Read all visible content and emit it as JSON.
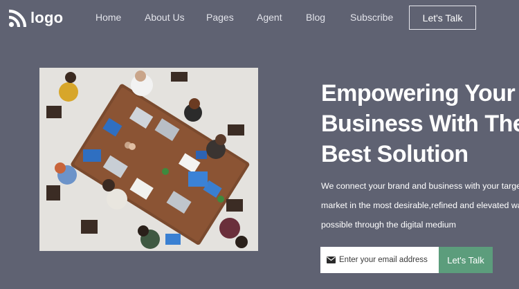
{
  "brand": {
    "logo_text": "logo",
    "logo_icon": "rss-feed-icon"
  },
  "nav": {
    "links": [
      "Home",
      "About Us",
      "Pages",
      "Agent",
      "Blog",
      "Subscribe"
    ],
    "cta_label": "Let's Talk"
  },
  "hero": {
    "image": "team-meeting-overhead-photo",
    "headline_lines": [
      "Empowering Your",
      "Business With The",
      "Best Solution"
    ],
    "description_lines": [
      "We connect your brand and business with your target",
      "market in the most desirable,refined and elevated way",
      "possible through the digital medium"
    ]
  },
  "signup": {
    "email_placeholder": "Enter your email address",
    "email_icon": "envelope-icon",
    "submit_label": "Let's Talk",
    "submit_color": "#5c9d7c"
  },
  "colors": {
    "background": "#5f6272",
    "text": "#ffffff",
    "accent": "#5c9d7c"
  }
}
